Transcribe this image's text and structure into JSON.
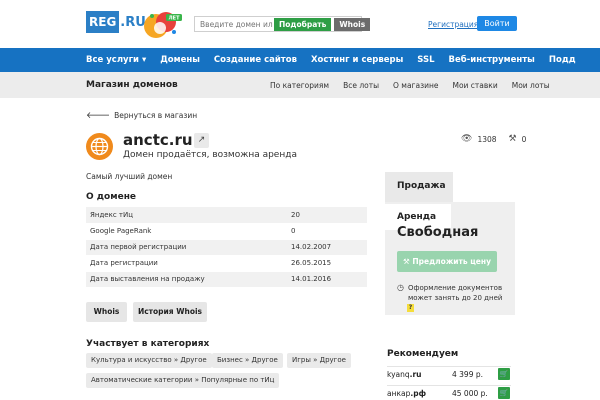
{
  "header": {
    "logo_text": "REG",
    "logo_suffix": ".RU",
    "anniversary_badge": "ЛЕТ",
    "search_placeholder": "Введите домен или",
    "pick_button": "Подобрать",
    "whois_button": "Whois",
    "register_link": "Регистрация",
    "login_button": "Войти"
  },
  "main_nav": [
    "Все услуги ▾",
    "Домены",
    "Создание сайтов",
    "Хостинг и серверы",
    "SSL",
    "Веб-инструменты",
    "Подд"
  ],
  "sub_nav": {
    "title": "Магазин доменов",
    "links": [
      "По категориям",
      "Все лоты",
      "О магазине",
      "Мои ставки",
      "Мои лоты"
    ]
  },
  "back_link": "Вернуться в магазин",
  "domain": {
    "name": "anctc.ru",
    "status": "Домен продаётся, возможна аренда",
    "views": "1308",
    "bids": "0",
    "description": "Самый лучший домен"
  },
  "about": {
    "title": "О домене",
    "rows": [
      {
        "label": "Яндекс тИц",
        "value": "20"
      },
      {
        "label": "Google PageRank",
        "value": "0"
      },
      {
        "label": "Дата первой регистрации",
        "value": "14.02.2007"
      },
      {
        "label": "Дата регистрации",
        "value": "26.05.2015"
      },
      {
        "label": "Дата выставления на продажу",
        "value": "14.01.2016"
      }
    ]
  },
  "actions": {
    "whois": "Whois",
    "whois_history": "История Whois"
  },
  "categories": {
    "title": "Участвует в категориях",
    "tags": [
      "Культура и искусство » Другое",
      "Бизнес » Другое",
      "Игры » Другое",
      "Автоматические категории » Популярные по тИц"
    ]
  },
  "panel": {
    "tab_sale": "Продажа",
    "tab_rent": "Аренда",
    "status": "Свободная",
    "offer_button": "Предложить цену",
    "doc_note": "Оформление документов может занять до 20 дней",
    "help_mark": "?"
  },
  "recommend": {
    "title": "Рекомендуем",
    "items": [
      {
        "domain_base": "kyanq",
        "domain_tld": ".ru",
        "price": "4 399 р."
      },
      {
        "domain_base": "анкар",
        "domain_tld": ".рф",
        "price": "45 000 р."
      }
    ]
  },
  "colors": {
    "brand_blue": "#1672c2",
    "green": "#2e9e45",
    "link": "#1f6fbf",
    "yellow": "#f5dd3b"
  }
}
